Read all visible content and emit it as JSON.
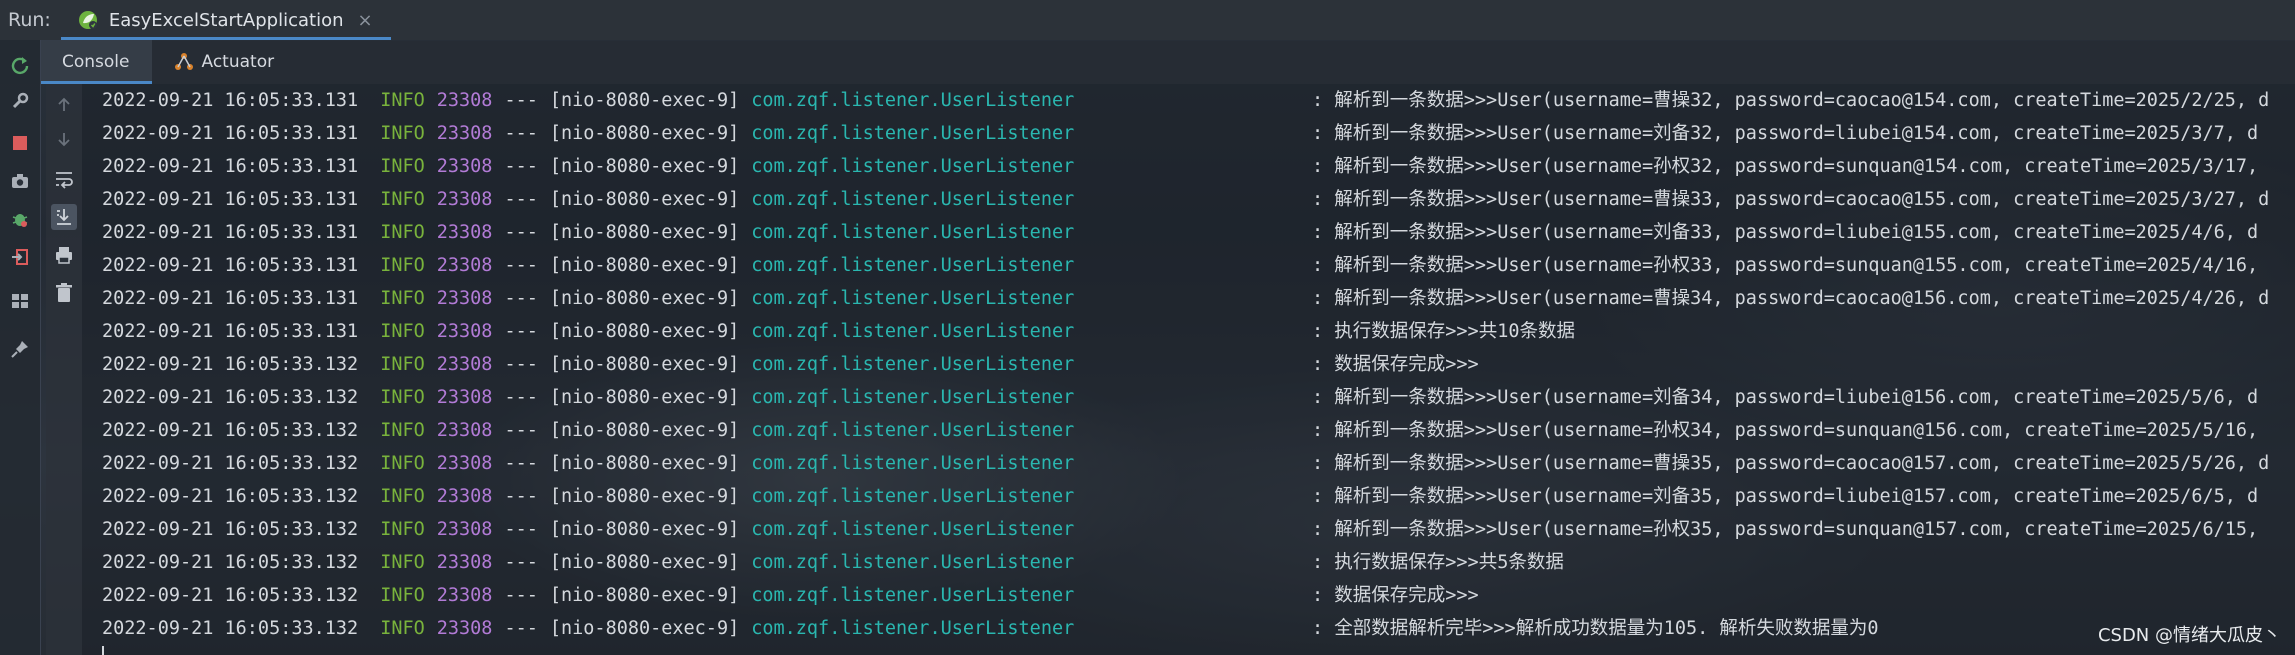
{
  "run_bar": {
    "label": "Run:",
    "tab_label": "EasyExcelStartApplication",
    "close": "×"
  },
  "sub_tabs": [
    {
      "label": "Console",
      "active": true
    },
    {
      "label": "Actuator",
      "active": false
    }
  ],
  "left_toolbar_icons": [
    "rerun-icon",
    "wrench-icon",
    "stop-icon",
    "camera-icon",
    "bug-icon",
    "exit-icon",
    "layout-icon",
    "pin-icon"
  ],
  "side_toolbar_icons": [
    "up-arrow-icon",
    "down-arrow-icon",
    "soft-wrap-icon",
    "scroll-to-end-icon",
    "print-icon",
    "trash-icon"
  ],
  "log_lines": [
    {
      "ts": "2022-09-21 16:05:33.131",
      "level": "INFO",
      "pid": "23308",
      "sep": "---",
      "thread": "[nio-8080-exec-9]",
      "logger": "com.zqf.listener.UserListener",
      "message": ": 解析到一条数据>>>User(username=曹操32, password=caocao@154.com, createTime=2025/2/25, d"
    },
    {
      "ts": "2022-09-21 16:05:33.131",
      "level": "INFO",
      "pid": "23308",
      "sep": "---",
      "thread": "[nio-8080-exec-9]",
      "logger": "com.zqf.listener.UserListener",
      "message": ": 解析到一条数据>>>User(username=刘备32, password=liubei@154.com, createTime=2025/3/7, d"
    },
    {
      "ts": "2022-09-21 16:05:33.131",
      "level": "INFO",
      "pid": "23308",
      "sep": "---",
      "thread": "[nio-8080-exec-9]",
      "logger": "com.zqf.listener.UserListener",
      "message": ": 解析到一条数据>>>User(username=孙权32, password=sunquan@154.com, createTime=2025/3/17,"
    },
    {
      "ts": "2022-09-21 16:05:33.131",
      "level": "INFO",
      "pid": "23308",
      "sep": "---",
      "thread": "[nio-8080-exec-9]",
      "logger": "com.zqf.listener.UserListener",
      "message": ": 解析到一条数据>>>User(username=曹操33, password=caocao@155.com, createTime=2025/3/27, d"
    },
    {
      "ts": "2022-09-21 16:05:33.131",
      "level": "INFO",
      "pid": "23308",
      "sep": "---",
      "thread": "[nio-8080-exec-9]",
      "logger": "com.zqf.listener.UserListener",
      "message": ": 解析到一条数据>>>User(username=刘备33, password=liubei@155.com, createTime=2025/4/6, d"
    },
    {
      "ts": "2022-09-21 16:05:33.131",
      "level": "INFO",
      "pid": "23308",
      "sep": "---",
      "thread": "[nio-8080-exec-9]",
      "logger": "com.zqf.listener.UserListener",
      "message": ": 解析到一条数据>>>User(username=孙权33, password=sunquan@155.com, createTime=2025/4/16,"
    },
    {
      "ts": "2022-09-21 16:05:33.131",
      "level": "INFO",
      "pid": "23308",
      "sep": "---",
      "thread": "[nio-8080-exec-9]",
      "logger": "com.zqf.listener.UserListener",
      "message": ": 解析到一条数据>>>User(username=曹操34, password=caocao@156.com, createTime=2025/4/26, d"
    },
    {
      "ts": "2022-09-21 16:05:33.131",
      "level": "INFO",
      "pid": "23308",
      "sep": "---",
      "thread": "[nio-8080-exec-9]",
      "logger": "com.zqf.listener.UserListener",
      "message": ": 执行数据保存>>>共10条数据"
    },
    {
      "ts": "2022-09-21 16:05:33.132",
      "level": "INFO",
      "pid": "23308",
      "sep": "---",
      "thread": "[nio-8080-exec-9]",
      "logger": "com.zqf.listener.UserListener",
      "message": ": 数据保存完成>>>"
    },
    {
      "ts": "2022-09-21 16:05:33.132",
      "level": "INFO",
      "pid": "23308",
      "sep": "---",
      "thread": "[nio-8080-exec-9]",
      "logger": "com.zqf.listener.UserListener",
      "message": ": 解析到一条数据>>>User(username=刘备34, password=liubei@156.com, createTime=2025/5/6, d"
    },
    {
      "ts": "2022-09-21 16:05:33.132",
      "level": "INFO",
      "pid": "23308",
      "sep": "---",
      "thread": "[nio-8080-exec-9]",
      "logger": "com.zqf.listener.UserListener",
      "message": ": 解析到一条数据>>>User(username=孙权34, password=sunquan@156.com, createTime=2025/5/16,"
    },
    {
      "ts": "2022-09-21 16:05:33.132",
      "level": "INFO",
      "pid": "23308",
      "sep": "---",
      "thread": "[nio-8080-exec-9]",
      "logger": "com.zqf.listener.UserListener",
      "message": ": 解析到一条数据>>>User(username=曹操35, password=caocao@157.com, createTime=2025/5/26, d"
    },
    {
      "ts": "2022-09-21 16:05:33.132",
      "level": "INFO",
      "pid": "23308",
      "sep": "---",
      "thread": "[nio-8080-exec-9]",
      "logger": "com.zqf.listener.UserListener",
      "message": ": 解析到一条数据>>>User(username=刘备35, password=liubei@157.com, createTime=2025/6/5, d"
    },
    {
      "ts": "2022-09-21 16:05:33.132",
      "level": "INFO",
      "pid": "23308",
      "sep": "---",
      "thread": "[nio-8080-exec-9]",
      "logger": "com.zqf.listener.UserListener",
      "message": ": 解析到一条数据>>>User(username=孙权35, password=sunquan@157.com, createTime=2025/6/15,"
    },
    {
      "ts": "2022-09-21 16:05:33.132",
      "level": "INFO",
      "pid": "23308",
      "sep": "---",
      "thread": "[nio-8080-exec-9]",
      "logger": "com.zqf.listener.UserListener",
      "message": ": 执行数据保存>>>共5条数据"
    },
    {
      "ts": "2022-09-21 16:05:33.132",
      "level": "INFO",
      "pid": "23308",
      "sep": "---",
      "thread": "[nio-8080-exec-9]",
      "logger": "com.zqf.listener.UserListener",
      "message": ": 数据保存完成>>>"
    },
    {
      "ts": "2022-09-21 16:05:33.132",
      "level": "INFO",
      "pid": "23308",
      "sep": "---",
      "thread": "[nio-8080-exec-9]",
      "logger": "com.zqf.listener.UserListener",
      "message": ": 全部数据解析完毕>>>解析成功数据量为105. 解析失败数据量为0"
    }
  ],
  "watermark": "CSDN @情绪大瓜皮丶",
  "colors": {
    "info": "#79b33c",
    "pid": "#b27bd6",
    "logger": "#2ab7b0",
    "text": "#d4d8dd",
    "accent": "#4a88c7"
  }
}
